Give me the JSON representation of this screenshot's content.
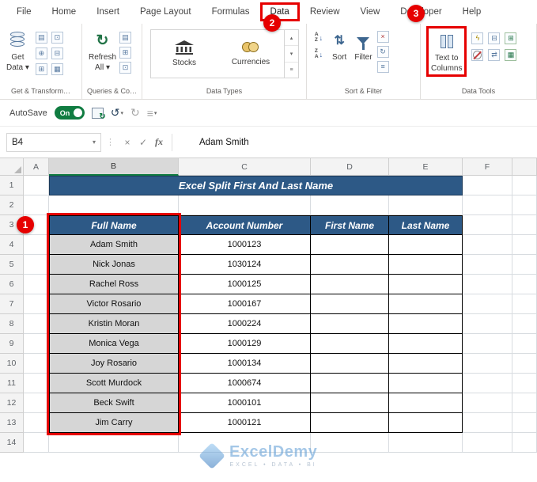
{
  "colors": {
    "header_blue": "#2D5986",
    "annotation_red": "#E60000",
    "selection_gray": "#D6D6D6",
    "autosave_green": "#107C41",
    "brand_blue": "#5B9BD5"
  },
  "ribbon": {
    "tabs": [
      "File",
      "Home",
      "Insert",
      "Page Layout",
      "Formulas",
      "Data",
      "Review",
      "View",
      "Developer",
      "Help"
    ],
    "active_tab": "Data",
    "groups": {
      "get_transform": {
        "label": "Get & Transform…",
        "get_data": "Get\nData ▾"
      },
      "queries": {
        "label": "Queries & Co…",
        "refresh_all": "Refresh\nAll ▾"
      },
      "data_types": {
        "label": "Data Types",
        "stocks": "Stocks",
        "currencies": "Currencies"
      },
      "sort_filter": {
        "label": "Sort & Filter",
        "sort": "Sort",
        "filter": "Filter"
      },
      "data_tools": {
        "label": "Data Tools",
        "text_to_columns": "Text to\nColumns"
      }
    }
  },
  "annotations": {
    "step1": "1",
    "step2": "2",
    "step3": "3"
  },
  "quick_access": {
    "autosave": "AutoSave",
    "autosave_state": "On"
  },
  "formula_bar": {
    "name_box": "B4",
    "value": "Adam Smith"
  },
  "glyphs": {
    "dropdown": "▾",
    "up": "▴",
    "down": "▾",
    "menu": "≡",
    "undo": "↺",
    "redo": "↻",
    "refresh": "↻",
    "cancel": "×",
    "check": "✓",
    "fx": "fx",
    "more": "⋮",
    "letter_a": "A",
    "letter_z": "Z",
    "arrow_down": "↓",
    "sort_updown": "⇅",
    "sheet": "▤",
    "table": "⊞",
    "grid": "▦",
    "minus_box": "⊟",
    "dot_box": "⊡",
    "plus_circle": "⊕",
    "clear": "×",
    "lightning": "ϟ",
    "swap": "⇄"
  },
  "sheet": {
    "columns": [
      "A",
      "B",
      "C",
      "D",
      "E",
      "F"
    ],
    "rows": [
      "1",
      "2",
      "3",
      "4",
      "5",
      "6",
      "7",
      "8",
      "9",
      "10",
      "11",
      "12",
      "13",
      "14"
    ],
    "title": "Excel Split First And Last Name",
    "table": {
      "headers": [
        "Full Name",
        "Account Number",
        "First Name",
        "Last Name"
      ],
      "rows": [
        {
          "full_name": "Adam Smith",
          "account_number": "1000123"
        },
        {
          "full_name": "Nick Jonas",
          "account_number": "1030124"
        },
        {
          "full_name": "Rachel Ross",
          "account_number": "1000125"
        },
        {
          "full_name": "Victor Rosario",
          "account_number": "1000167"
        },
        {
          "full_name": "Kristin Moran",
          "account_number": "1000224"
        },
        {
          "full_name": "Monica Vega",
          "account_number": "1000129"
        },
        {
          "full_name": "Joy Rosario",
          "account_number": "1000134"
        },
        {
          "full_name": "Scott Murdock",
          "account_number": "1000674"
        },
        {
          "full_name": "Beck Swift",
          "account_number": "1000101"
        },
        {
          "full_name": "Jim Carry",
          "account_number": "1000121"
        }
      ]
    }
  },
  "watermark": {
    "brand": "ExcelDemy",
    "tagline": "EXCEL • DATA • BI"
  }
}
